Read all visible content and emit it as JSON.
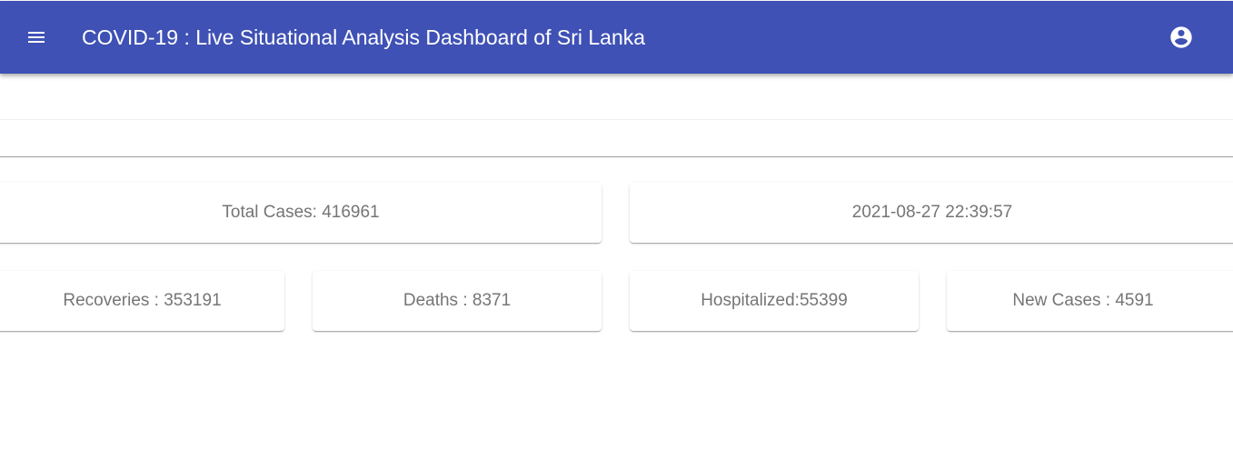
{
  "header": {
    "title": "COVID-19 : Live Situational Analysis Dashboard of Sri Lanka",
    "menu_icon": "menu-icon",
    "account_icon": "account-circle-icon",
    "background_color": "#3f51b5"
  },
  "stats": {
    "total_cases": "Total Cases: 416961",
    "updated_at": "2021-08-27 22:39:57",
    "recoveries": "Recoveries : 353191",
    "deaths": "Deaths : 8371",
    "hospitalized": "Hospitalized:55399",
    "new_cases": "New Cases : 4591"
  }
}
